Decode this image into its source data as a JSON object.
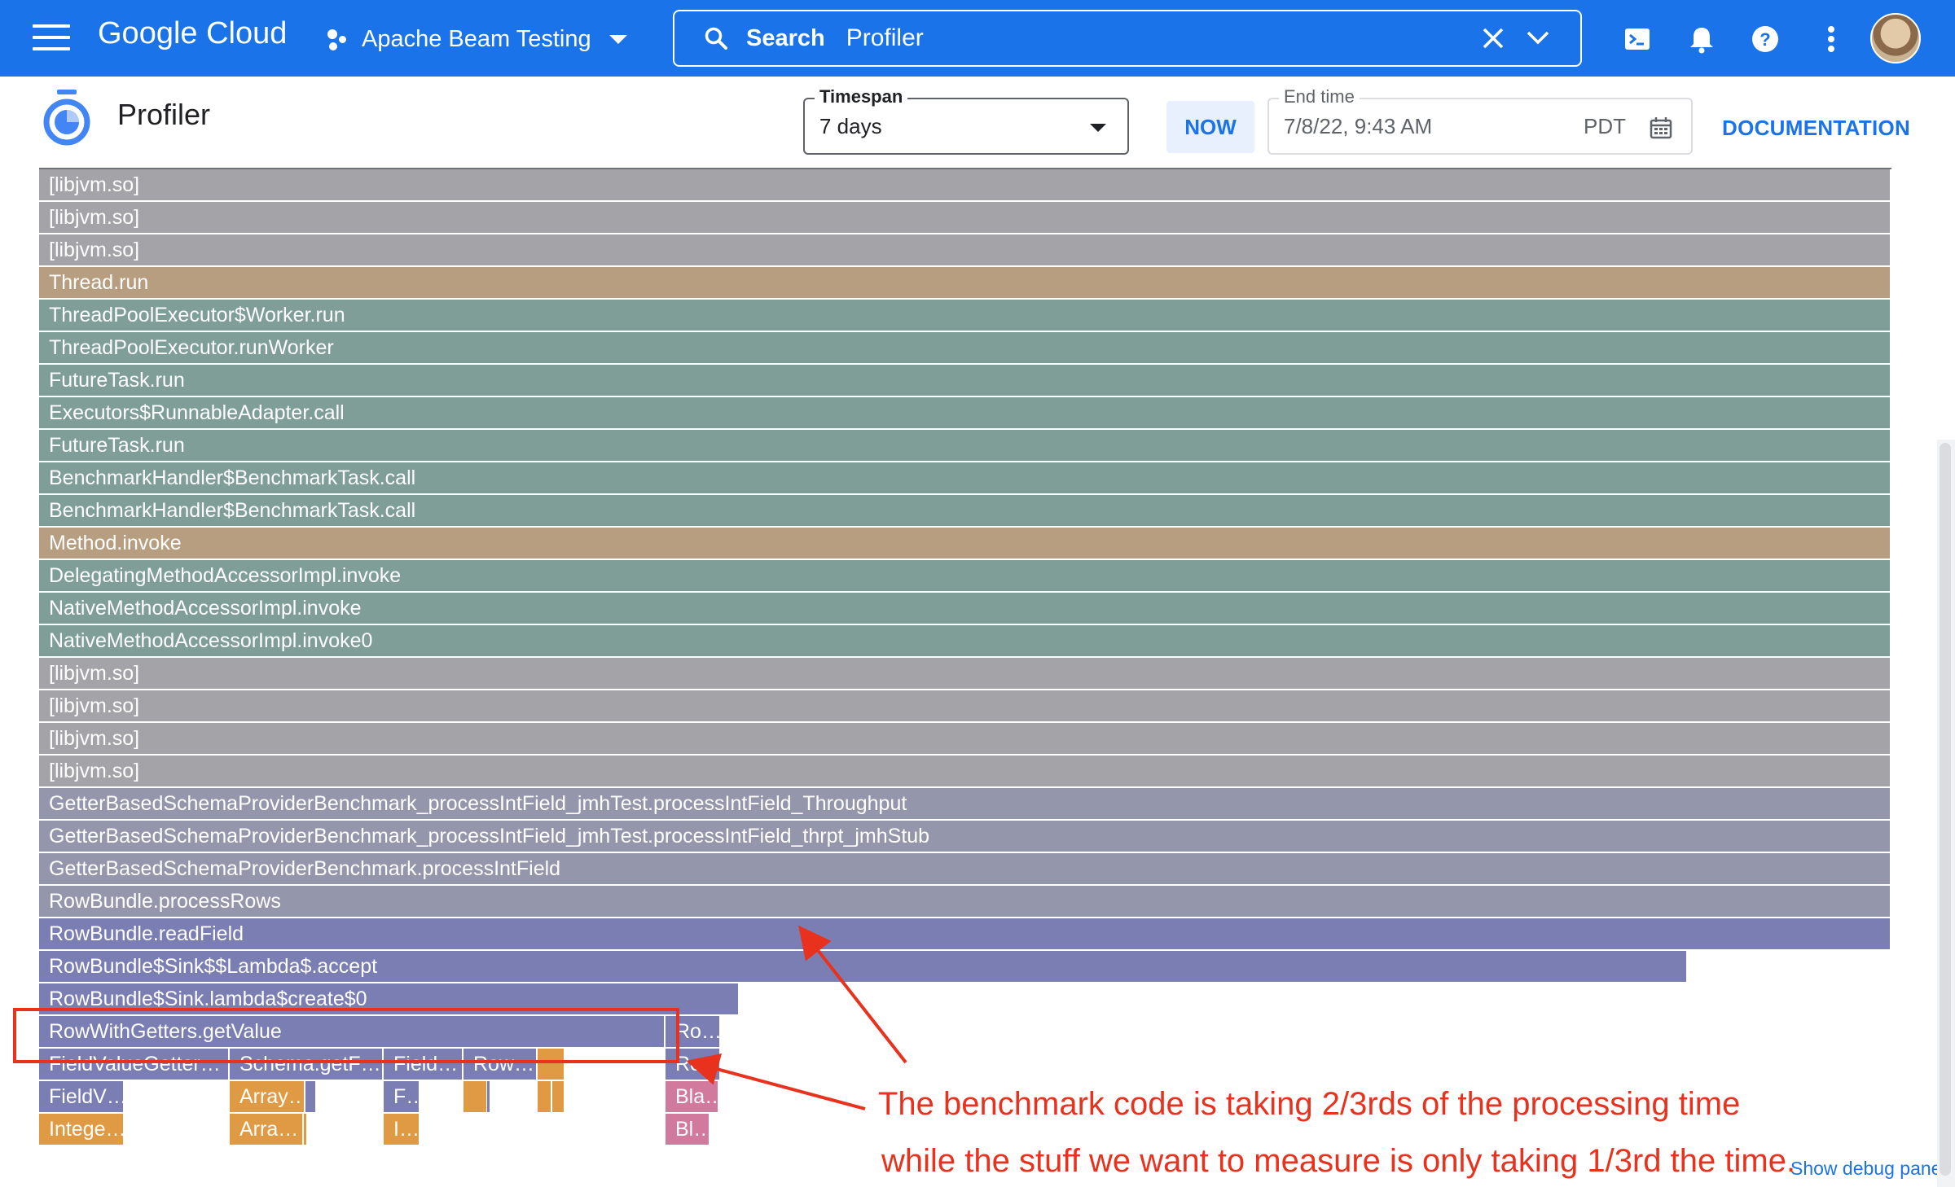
{
  "topbar": {
    "logo_text": "Google Cloud",
    "project_name": "Apache Beam Testing",
    "search_label": "Search",
    "search_value": "Profiler",
    "icons": [
      "menu-icon",
      "project-icon",
      "search-icon",
      "close-icon",
      "chevron-down-icon",
      "cloud-shell-icon",
      "notifications-icon",
      "help-icon",
      "more-vert-icon"
    ]
  },
  "header": {
    "title": "Profiler",
    "timespan_label": "Timespan",
    "timespan_value": "7 days",
    "now_label": "NOW",
    "endtime_label": "End time",
    "endtime_value": "7/8/22, 9:43 AM",
    "endtime_tz": "PDT",
    "documentation_label": "DOCUMENTATION"
  },
  "colors": {
    "brand": "#1a73e8",
    "gray": "#a4a4a8",
    "tan": "#b89e80",
    "teal": "#7f9e98",
    "slate": "#9496ab",
    "blue_purple": "#7a7eb3",
    "orange": "#e09a43",
    "pink": "#d27a9e",
    "annotation": "#e8321e"
  },
  "flame_graph": {
    "frames": [
      {
        "label": "[libjvm.so]",
        "depth": 0,
        "start": 0,
        "width": 1,
        "color": "gray"
      },
      {
        "label": "[libjvm.so]",
        "depth": 1,
        "start": 0,
        "width": 1,
        "color": "gray"
      },
      {
        "label": "[libjvm.so]",
        "depth": 2,
        "start": 0,
        "width": 1,
        "color": "gray"
      },
      {
        "label": "Thread.run",
        "depth": 3,
        "start": 0,
        "width": 1,
        "color": "tan"
      },
      {
        "label": "ThreadPoolExecutor$Worker.run",
        "depth": 4,
        "start": 0,
        "width": 1,
        "color": "teal"
      },
      {
        "label": "ThreadPoolExecutor.runWorker",
        "depth": 5,
        "start": 0,
        "width": 1,
        "color": "teal"
      },
      {
        "label": "FutureTask.run",
        "depth": 6,
        "start": 0,
        "width": 1,
        "color": "teal"
      },
      {
        "label": "Executors$RunnableAdapter.call",
        "depth": 7,
        "start": 0,
        "width": 1,
        "color": "teal"
      },
      {
        "label": "FutureTask.run",
        "depth": 8,
        "start": 0,
        "width": 1,
        "color": "teal"
      },
      {
        "label": "BenchmarkHandler$BenchmarkTask.call",
        "depth": 9,
        "start": 0,
        "width": 1,
        "color": "teal"
      },
      {
        "label": "BenchmarkHandler$BenchmarkTask.call",
        "depth": 10,
        "start": 0,
        "width": 1,
        "color": "teal"
      },
      {
        "label": "Method.invoke",
        "depth": 11,
        "start": 0,
        "width": 1,
        "color": "tan"
      },
      {
        "label": "DelegatingMethodAccessorImpl.invoke",
        "depth": 12,
        "start": 0,
        "width": 1,
        "color": "teal"
      },
      {
        "label": "NativeMethodAccessorImpl.invoke",
        "depth": 13,
        "start": 0,
        "width": 1,
        "color": "teal"
      },
      {
        "label": "NativeMethodAccessorImpl.invoke0",
        "depth": 14,
        "start": 0,
        "width": 1,
        "color": "teal"
      },
      {
        "label": "[libjvm.so]",
        "depth": 15,
        "start": 0,
        "width": 1,
        "color": "gray"
      },
      {
        "label": "[libjvm.so]",
        "depth": 16,
        "start": 0,
        "width": 1,
        "color": "gray"
      },
      {
        "label": "[libjvm.so]",
        "depth": 17,
        "start": 0,
        "width": 1,
        "color": "gray"
      },
      {
        "label": "[libjvm.so]",
        "depth": 18,
        "start": 0,
        "width": 1,
        "color": "gray"
      },
      {
        "label": "GetterBasedSchemaProviderBenchmark_processIntField_jmhTest.processIntField_Throughput",
        "depth": 19,
        "start": 0,
        "width": 1,
        "color": "slate"
      },
      {
        "label": "GetterBasedSchemaProviderBenchmark_processIntField_jmhTest.processIntField_thrpt_jmhStub",
        "depth": 20,
        "start": 0,
        "width": 1,
        "color": "slate"
      },
      {
        "label": "GetterBasedSchemaProviderBenchmark.processIntField",
        "depth": 21,
        "start": 0,
        "width": 1,
        "color": "slate"
      },
      {
        "label": "RowBundle.processRows",
        "depth": 22,
        "start": 0,
        "width": 1,
        "color": "slate"
      },
      {
        "label": "RowBundle.readField",
        "depth": 23,
        "start": 0,
        "width": 1,
        "color": "blue_purple"
      },
      {
        "label": "RowBundle$Sink$$Lambda$.accept",
        "depth": 24,
        "start": 0,
        "width": 0.89,
        "color": "blue_purple"
      },
      {
        "label": "RowBundle$Sink.lambda$create$0",
        "depth": 25,
        "start": 0,
        "width": 0.378,
        "color": "blue_purple"
      },
      {
        "label": "RowWithGetters.getValue",
        "depth": 26,
        "start": 0,
        "width": 0.338,
        "color": "blue_purple"
      },
      {
        "label": "Ro…",
        "depth": 26,
        "start": 0.338,
        "width": 0.03,
        "color": "blue_purple"
      },
      {
        "label": "FieldValueGetter…",
        "depth": 27,
        "start": 0,
        "width": 0.103,
        "color": "blue_purple"
      },
      {
        "label": "Schema.getF…",
        "depth": 27,
        "start": 0.103,
        "width": 0.083,
        "color": "blue_purple"
      },
      {
        "label": "Field…",
        "depth": 27,
        "start": 0.186,
        "width": 0.043,
        "color": "blue_purple"
      },
      {
        "label": "Row…",
        "depth": 27,
        "start": 0.229,
        "width": 0.04,
        "color": "blue_purple"
      },
      {
        "label": "",
        "depth": 27,
        "start": 0.269,
        "width": 0.015,
        "color": "orange"
      },
      {
        "label": "Ro…",
        "depth": 27,
        "start": 0.338,
        "width": 0.03,
        "color": "blue_purple"
      },
      {
        "label": "FieldV…",
        "depth": 28,
        "start": 0,
        "width": 0.046,
        "color": "blue_purple"
      },
      {
        "label": "Array…",
        "depth": 28,
        "start": 0.103,
        "width": 0.041,
        "color": "orange"
      },
      {
        "label": "",
        "depth": 28,
        "start": 0.144,
        "width": 0.006,
        "color": "blue_purple"
      },
      {
        "label": "F…",
        "depth": 28,
        "start": 0.186,
        "width": 0.02,
        "color": "blue_purple"
      },
      {
        "label": "",
        "depth": 28,
        "start": 0.229,
        "width": 0.013,
        "color": "orange"
      },
      {
        "label": "",
        "depth": 28,
        "start": 0.242,
        "width": 0.002,
        "color": "blue_purple"
      },
      {
        "label": "",
        "depth": 28,
        "start": 0.269,
        "width": 0.008,
        "color": "orange"
      },
      {
        "label": "",
        "depth": 28,
        "start": 0.277,
        "width": 0.007,
        "color": "orange"
      },
      {
        "label": "Bla…",
        "depth": 28,
        "start": 0.338,
        "width": 0.029,
        "color": "pink"
      },
      {
        "label": "Intege…",
        "depth": 29,
        "start": 0,
        "width": 0.046,
        "color": "orange"
      },
      {
        "label": "Arra…",
        "depth": 29,
        "start": 0.103,
        "width": 0.04,
        "color": "orange"
      },
      {
        "label": "",
        "depth": 29,
        "start": 0.143,
        "width": 0.002,
        "color": "orange"
      },
      {
        "label": "I…",
        "depth": 29,
        "start": 0.186,
        "width": 0.02,
        "color": "orange"
      },
      {
        "label": "Bl…",
        "depth": 29,
        "start": 0.338,
        "width": 0.024,
        "color": "pink"
      }
    ]
  },
  "annotations": {
    "line1": "The benchmark code is taking 2/3rds of the processing time",
    "line2": "while the stuff we want to measure is only taking 1/3rd the time."
  },
  "debug_link": "Show debug panel"
}
